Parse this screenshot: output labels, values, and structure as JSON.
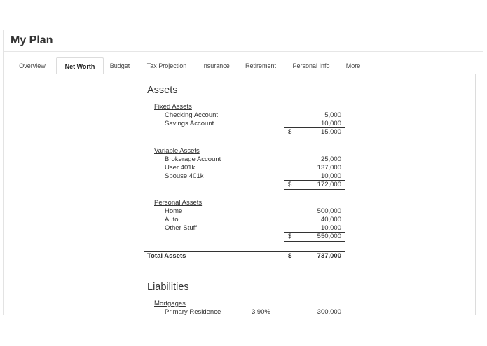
{
  "page": {
    "title": "My Plan"
  },
  "tabs": [
    {
      "label": "Overview"
    },
    {
      "label": "Net Worth"
    },
    {
      "label": "Budget"
    },
    {
      "label": "Tax Projection"
    },
    {
      "label": "Insurance"
    },
    {
      "label": "Retirement"
    },
    {
      "label": "Personal Info"
    },
    {
      "label": "More"
    }
  ],
  "active_tab": "Net Worth",
  "assets": {
    "heading": "Assets",
    "fixed": {
      "label": "Fixed Assets",
      "items": [
        {
          "name": "Checking Account",
          "value": "5,000"
        },
        {
          "name": "Savings Account",
          "value": "10,000"
        }
      ],
      "total": "15,000"
    },
    "variable": {
      "label": "Variable Assets",
      "items": [
        {
          "name": "Brokerage Account",
          "value": "25,000"
        },
        {
          "name": "User 401k",
          "value": "137,000"
        },
        {
          "name": "Spouse 401k",
          "value": "10,000"
        }
      ],
      "total": "172,000"
    },
    "personal": {
      "label": "Personal Assets",
      "items": [
        {
          "name": "Home",
          "value": "500,000"
        },
        {
          "name": "Auto",
          "value": "40,000"
        },
        {
          "name": "Other Stuff",
          "value": "10,000"
        }
      ],
      "total": "550,000"
    },
    "total_label": "Total Assets",
    "total_value": "737,000"
  },
  "currency_symbol": "$",
  "liabilities": {
    "heading": "Liabilities",
    "mortgages": {
      "label": "Mortgages",
      "items": [
        {
          "name": "Primary Residence",
          "rate": "3.90%",
          "value": "300,000"
        }
      ]
    }
  }
}
